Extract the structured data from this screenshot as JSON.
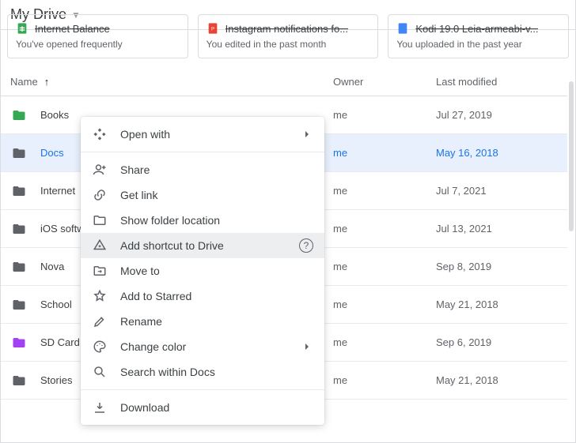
{
  "header": {
    "title": "My Drive"
  },
  "quick_cards": [
    {
      "title": "Internet Balance",
      "sub": "You've opened frequently",
      "icon_color": "#34a853"
    },
    {
      "title": "Instagram notifications fo...",
      "sub": "You edited in the past month",
      "icon_color": "#ea4335"
    },
    {
      "title": "Kodi 19.0 Leia-armeabi-v...",
      "sub": "You uploaded in the past year",
      "icon_color": "#4285f4"
    }
  ],
  "columns": {
    "name": "Name",
    "owner": "Owner",
    "modified": "Last modified"
  },
  "rows": [
    {
      "name": "Books",
      "owner": "me",
      "modified": "Jul 27, 2019",
      "color": "#34a853",
      "selected": false
    },
    {
      "name": "Docs",
      "owner": "me",
      "modified": "May 16, 2018",
      "color": "#5f6368",
      "selected": true
    },
    {
      "name": "Internet",
      "owner": "me",
      "modified": "Jul 7, 2021",
      "color": "#5f6368",
      "selected": false
    },
    {
      "name": "iOS softwares",
      "owner": "me",
      "modified": "Jul 13, 2021",
      "color": "#5f6368",
      "selected": false
    },
    {
      "name": "Nova",
      "owner": "me",
      "modified": "Sep 8, 2019",
      "color": "#5f6368",
      "selected": false
    },
    {
      "name": "School",
      "owner": "me",
      "modified": "May 21, 2018",
      "color": "#5f6368",
      "selected": false
    },
    {
      "name": "SD Card",
      "owner": "me",
      "modified": "Sep 6, 2019",
      "color": "#a142f4",
      "selected": false
    },
    {
      "name": "Stories",
      "owner": "me",
      "modified": "May 21, 2018",
      "color": "#5f6368",
      "selected": false
    }
  ],
  "context_menu": {
    "open_with": "Open with",
    "share": "Share",
    "get_link": "Get link",
    "show_location": "Show folder location",
    "add_shortcut": "Add shortcut to Drive",
    "move_to": "Move to",
    "add_starred": "Add to Starred",
    "rename": "Rename",
    "change_color": "Change color",
    "search_within": "Search within Docs",
    "download": "Download"
  }
}
